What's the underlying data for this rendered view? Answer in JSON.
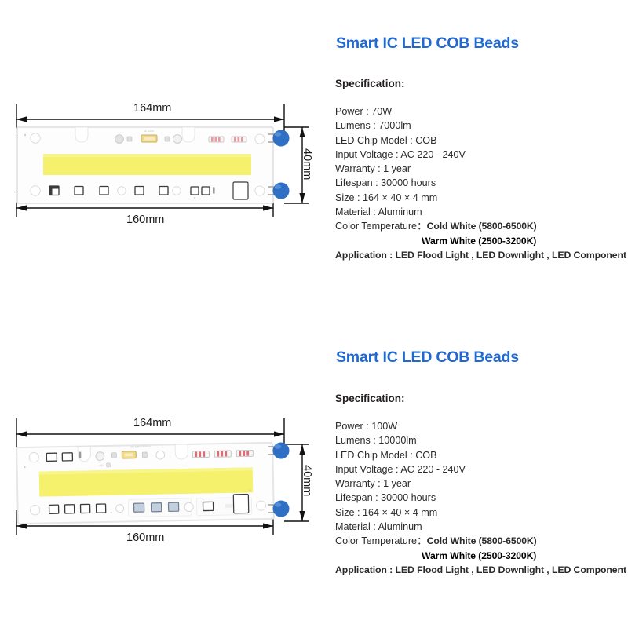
{
  "page": {
    "background": "#ffffff",
    "title_color": "#2069d0",
    "text_color": "#2a2a2a"
  },
  "products": [
    {
      "title": "Smart IC LED COB Beads",
      "spec_heading": "Specification:",
      "specs": [
        "Power : 70W",
        "Lumens : 7000lm",
        "LED Chip Model : COB",
        "Input Voltage : AC 220 - 240V",
        "Warranty : 1 year",
        "Lifespan : 30000 hours",
        "Size : 164 × 40 × 4 mm",
        "Material : Aluminum"
      ],
      "color_temperature": {
        "label": "Color Temperature：",
        "cold_white": "Cold White (5800-6500K)",
        "warm_white": "Warm White (2500-3200K)"
      },
      "application": "Application : LED Flood Light , LED Downlight , LED Component",
      "drawing": {
        "width_top": "164mm",
        "width_bottom": "160mm",
        "height": "40mm",
        "board_color": "#fdfdfd",
        "cob_color": "#f5f16c",
        "capacitor_color": "#2f6fc4"
      }
    },
    {
      "title": "Smart IC LED COB Beads",
      "spec_heading": "Specification:",
      "specs": [
        "Power : 100W",
        "Lumens : 10000lm",
        "LED Chip Model : COB",
        "Input Voltage : AC 220 - 240V",
        "Warranty : 1 year",
        "Lifespan : 30000 hours",
        "Size : 164 × 40 × 4 mm",
        "Material : Aluminum"
      ],
      "color_temperature": {
        "label": "Color Temperature：",
        "cold_white": "Cold White (5800-6500K)",
        "warm_white": "Warm White (2500-3200K)"
      },
      "application": "Application : LED Flood Light , LED Downlight , LED Component",
      "drawing": {
        "width_top": "164mm",
        "width_bottom": "160mm",
        "height": "40mm",
        "board_color": "#fdfdfd",
        "cob_color": "#f5f16c",
        "capacitor_color": "#2f6fc4"
      }
    }
  ]
}
